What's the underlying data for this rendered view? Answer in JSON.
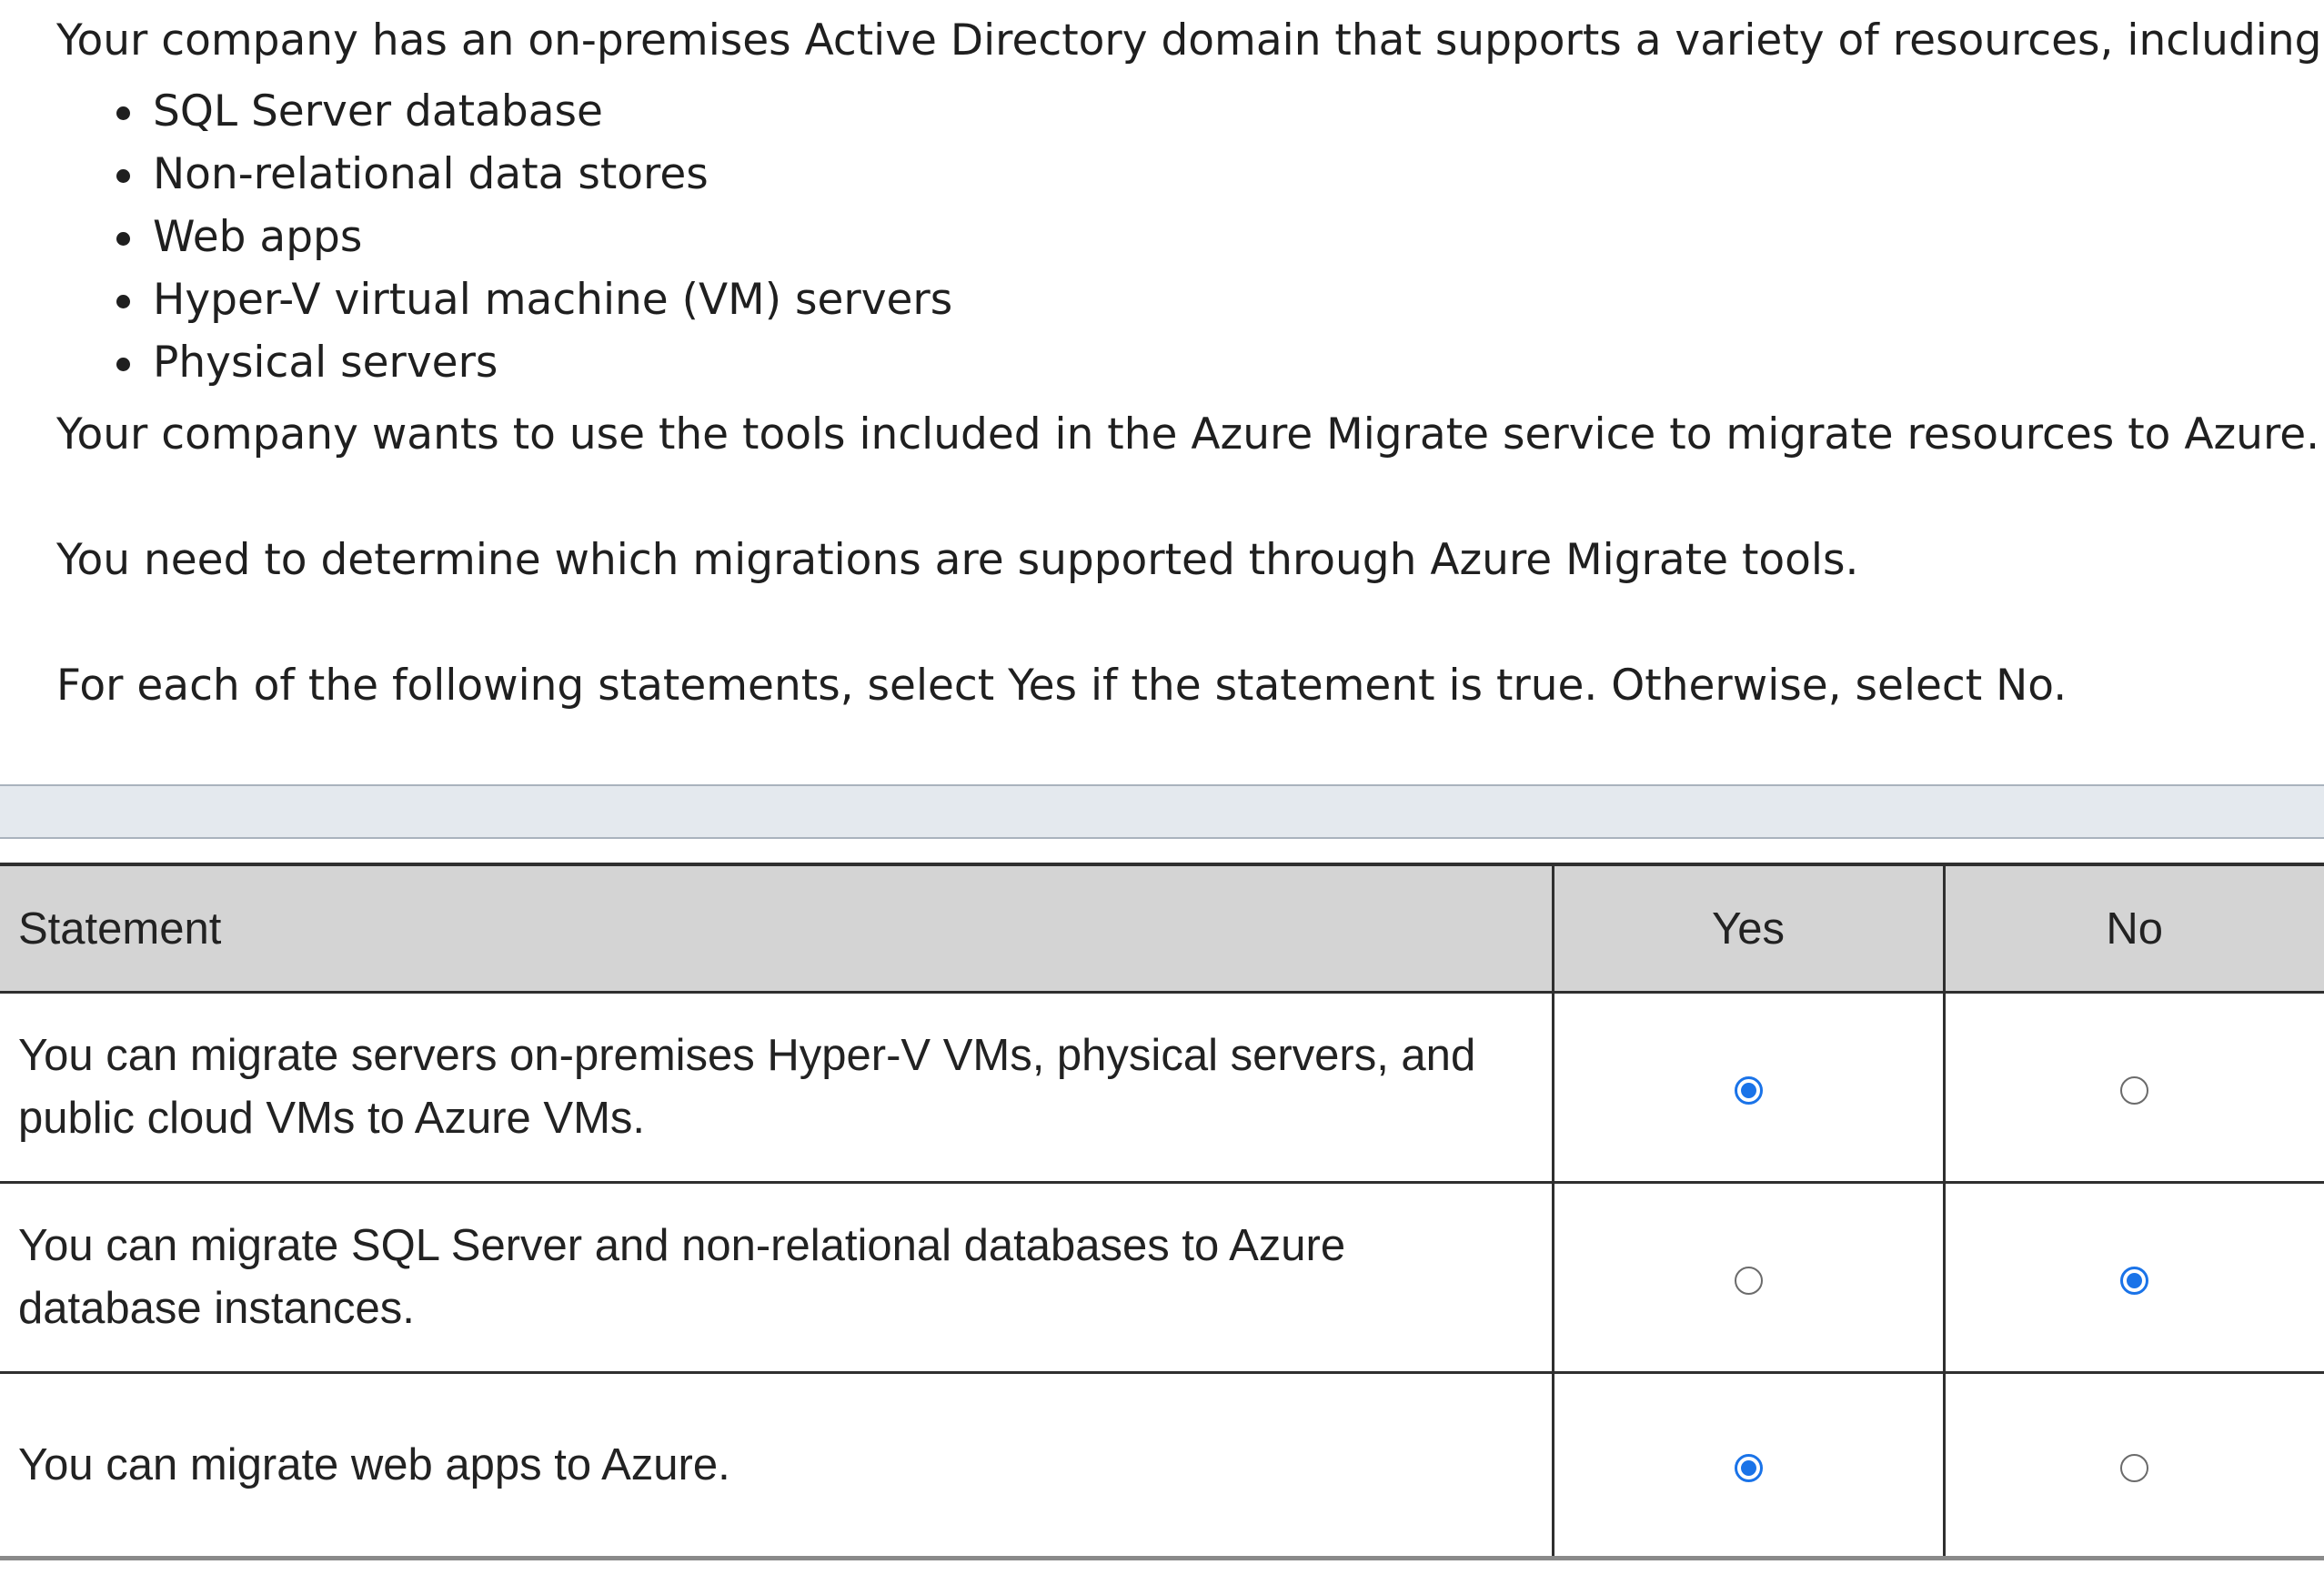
{
  "intro": {
    "lead": "Your company has an on-premises Active Directory domain that supports a variety of resources, including:",
    "resources": [
      "SQL Server database",
      "Non-relational data stores",
      "Web apps",
      "Hyper-V virtual machine (VM) servers",
      "Physical servers"
    ],
    "goal": "Your company wants to use the tools included in the Azure Migrate service to migrate resources to Azure.",
    "task": "You need to determine which migrations are supported through Azure Migrate tools.",
    "instruction": "For each of the following statements, select Yes if the statement is true. Otherwise, select No."
  },
  "table": {
    "headers": {
      "statement": "Statement",
      "yes": "Yes",
      "no": "No"
    },
    "rows": [
      {
        "statement": "You can migrate servers on-premises Hyper-V VMs, physical servers, and public cloud VMs to Azure VMs.",
        "selected": "yes"
      },
      {
        "statement": "You can migrate SQL Server and non-relational databases to Azure database instances.",
        "selected": "no"
      },
      {
        "statement": "You can migrate web apps to Azure.",
        "selected": "yes"
      }
    ]
  },
  "colors": {
    "radio_selected": "#1a73e8",
    "header_background": "#d4d4d4",
    "band_background": "#e4e9ee"
  }
}
